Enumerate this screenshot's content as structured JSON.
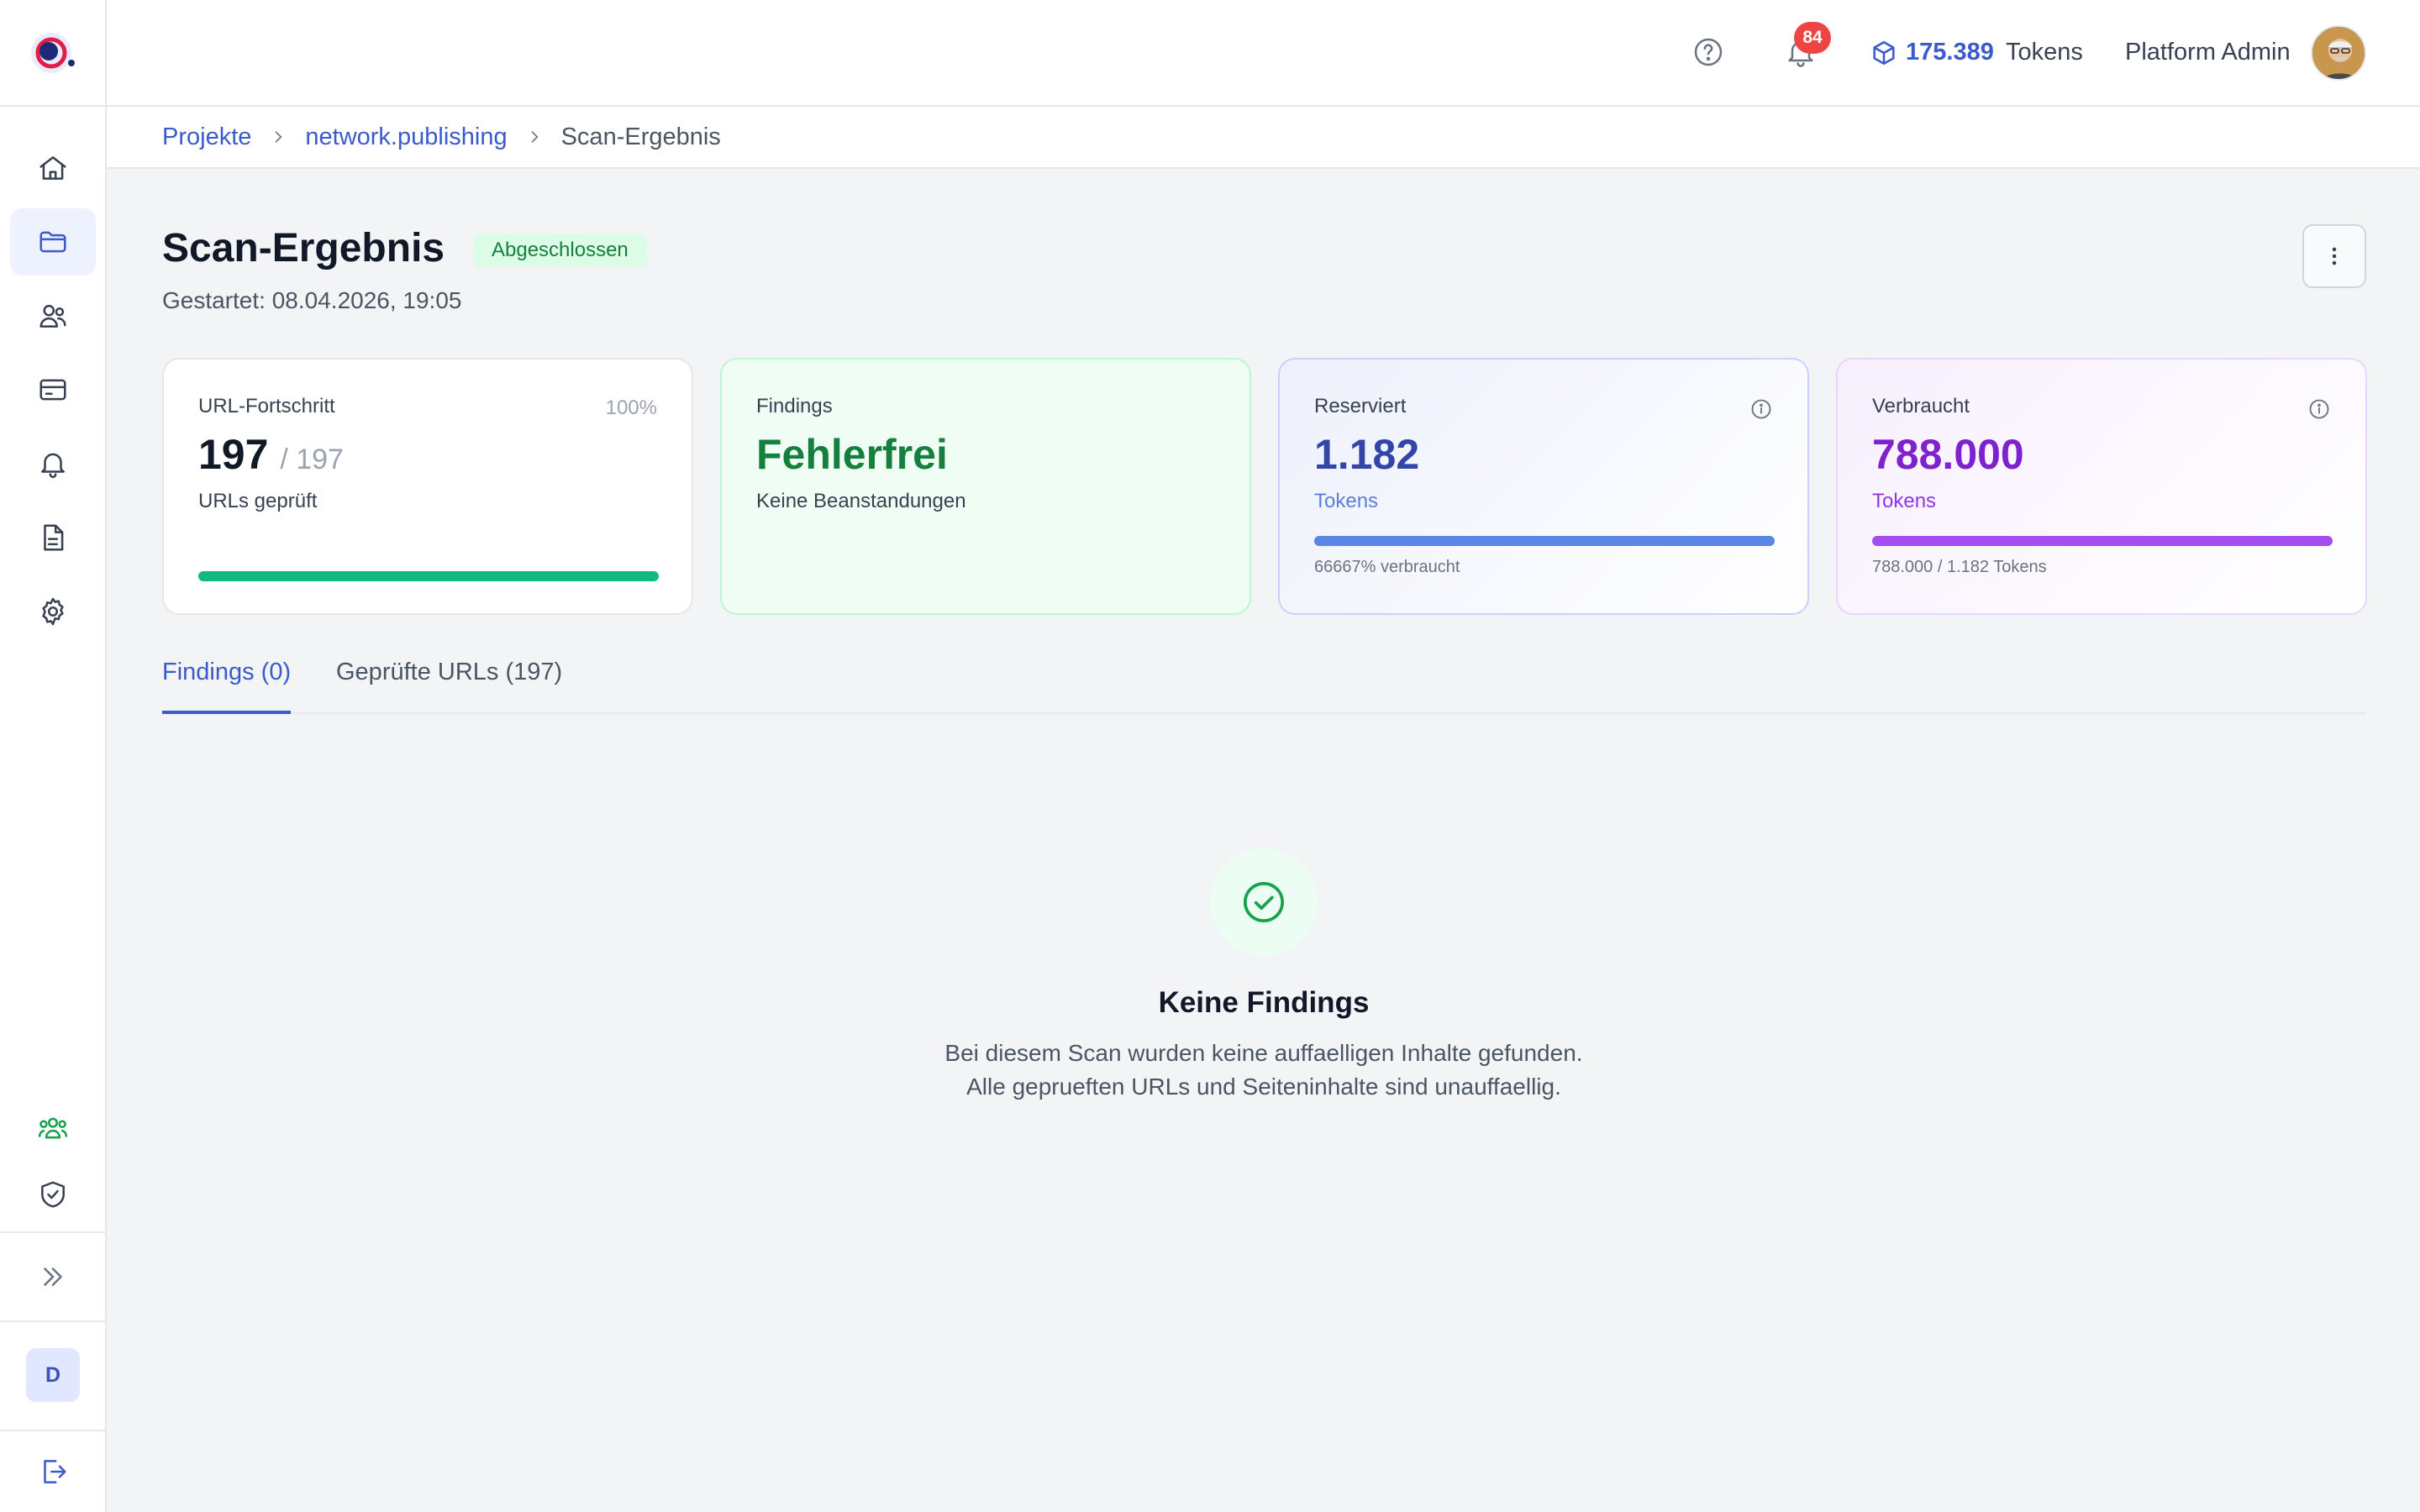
{
  "topbar": {
    "notification_count": "84",
    "token_balance": "175.389",
    "token_label": "Tokens",
    "user_name": "Platform Admin"
  },
  "sidebar": {
    "user_initial": "D",
    "items": [
      "home-icon",
      "folder-icon",
      "users-icon",
      "credit-card-icon",
      "bell-icon",
      "document-icon",
      "gear-icon",
      "team-icon",
      "shield-check-icon",
      "expand-icon",
      "logout-icon"
    ]
  },
  "breadcrumb": {
    "items": [
      "Projekte",
      "network.publishing",
      "Scan-Ergebnis"
    ]
  },
  "header": {
    "title": "Scan-Ergebnis",
    "status": "Abgeschlossen",
    "started": "Gestartet: 08.04.2026, 19:05"
  },
  "cards": {
    "progress": {
      "label": "URL-Fortschritt",
      "percent": "100%",
      "value": "197",
      "total": "/ 197",
      "sub": "URLs geprüft",
      "fill": 1.0
    },
    "findings": {
      "label": "Findings",
      "value": "Fehlerfrei",
      "sub": "Keine Beanstandungen"
    },
    "reserved": {
      "label": "Reserviert",
      "value": "1.182",
      "sub": "Tokens",
      "note": "66667% verbraucht",
      "fill": 1.0
    },
    "consumed": {
      "label": "Verbraucht",
      "value": "788.000",
      "sub": "Tokens",
      "note": "788.000 / 1.182 Tokens",
      "fill": 1.0
    }
  },
  "tabs": [
    {
      "label": "Findings (0)",
      "active": true
    },
    {
      "label": "Geprüfte URLs (197)",
      "active": false
    }
  ],
  "empty_state": {
    "title": "Keine Findings",
    "text": "Bei diesem Scan wurden keine auffaelligen Inhalte gefunden. Alle geprueften URLs und Seiteninhalte sind unauffaellig."
  },
  "colors": {
    "accent": "#3b5bcc",
    "success": "#15803d",
    "purple": "#7e22ce",
    "danger": "#ef4444"
  }
}
